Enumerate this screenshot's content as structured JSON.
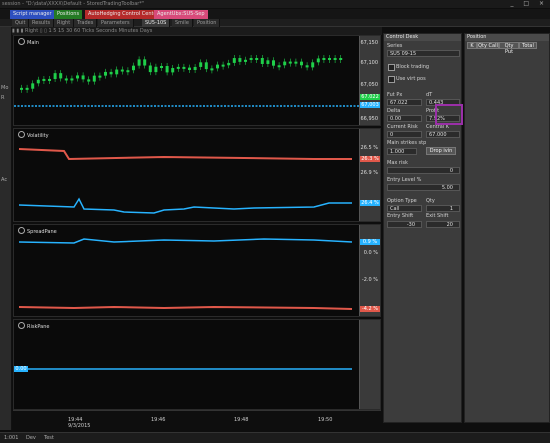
{
  "window": {
    "title": "session - \"D:\\data\\XXXX\\Default - StoredTradingToolbar*\"",
    "controls": "_ □ ×"
  },
  "top_tabs": [
    "Script manager",
    "Positions",
    "AutoHedging Control Center",
    "AgentUbx:SU5-Sep"
  ],
  "sub_tabs": [
    "Quit",
    "Results",
    "Right",
    "Trades",
    "Parameters",
    "SU5-10S",
    "Smile",
    "Position"
  ],
  "sidebar": {
    "items": [
      "Mo",
      "R",
      "Ac"
    ]
  },
  "toolbar": {
    "text": "▮ ▮ ▮  Right  ▯ ▯   1 5 15 30 60  Ticks  Seconds  Minutes  Days"
  },
  "panes": {
    "main": {
      "title": "Main",
      "ticks": [
        "67,150",
        "67,100",
        "67,050",
        "67,000",
        "66,950"
      ],
      "tags": [
        "67.022",
        "67,003"
      ]
    },
    "volatility": {
      "title": "Volatility",
      "ticks": [
        "26.5 %",
        "26.9 %"
      ],
      "tags": [
        "26.3 %",
        "26.4 %"
      ]
    },
    "spread": {
      "title": "SpreadPane",
      "ticks": [
        "0.0 %",
        "-2.0 %"
      ],
      "tags": [
        "0.9 %",
        "-4.2 %"
      ]
    },
    "risk": {
      "title": "RiskPane",
      "left_tag": "0.00"
    }
  },
  "x_axis": {
    "times": [
      "19:44",
      "19:46",
      "19:48",
      "19:50"
    ],
    "date": "9/3/2015"
  },
  "control_desk": {
    "title": "Control Desk",
    "series_label": "Series",
    "series_value": "SU5 09-15",
    "block_trading": "Block trading",
    "use_virt_pos": "Use virt pos",
    "fut_px_label": "Fut Px",
    "dt_label": "dT",
    "fut_px": "67.022",
    "dt": "0.443",
    "delta_label": "Delta",
    "profit_label": "Profit",
    "delta": "0.00",
    "profit": "7.92%",
    "current_risk_label": "Current Risk",
    "central_k_label": "Central K",
    "current_risk": "0",
    "central_k": "67.000",
    "main_strike_label": "Main strikes stp",
    "main_strike": "1.000",
    "drop_ivin": "Drop ivin",
    "max_risk_label": "Max risk",
    "max_risk": "0",
    "entry_level_label": "Entry Level %",
    "entry_level": "5.00",
    "option_type_label": "Option Type",
    "qty_label": "Qty",
    "option_type": "Call",
    "qty": "1",
    "entry_shift_label": "Entry Shift",
    "exit_shift_label": "Exit Shift",
    "entry_shift": "-30",
    "exit_shift": "20"
  },
  "position": {
    "title": "Position",
    "cols": [
      "K",
      "Qty Call",
      "Qty Put",
      "Total"
    ]
  },
  "status": {
    "tabs": [
      "1:001",
      "Dev",
      "Test"
    ]
  },
  "colors": {
    "candle_up": "#1fcf4a",
    "candle_down": "#1fcf4a",
    "blue_line": "#27b3ff",
    "red_line": "#e0584a",
    "highlight": "#9a2fa8"
  }
}
